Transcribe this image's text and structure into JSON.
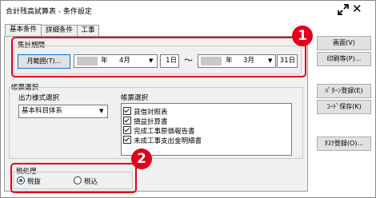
{
  "window": {
    "title": "合計残高試算表 - 条件設定"
  },
  "tabs": [
    {
      "label": "基本条件",
      "active": true
    },
    {
      "label": "詳細条件",
      "active": false
    },
    {
      "label": "工事",
      "active": false
    }
  ],
  "period": {
    "group_label": "集計期間",
    "range_button": "月範囲(T)...",
    "start_year_suffix": "年",
    "start_month": "4月",
    "start_day": "1日",
    "separator": "～",
    "end_year_suffix": "年",
    "end_month": "3月",
    "end_day": "31日"
  },
  "report_select": {
    "group_label": "帳票選択",
    "output_format_label": "出力様式選択",
    "output_format_value": "基本科目体系",
    "report_list_label": "帳票選択",
    "reports": [
      {
        "label": "貸借対照表",
        "checked": true
      },
      {
        "label": "損益計算書",
        "checked": true
      },
      {
        "label": "完成工事原価報告書",
        "checked": true
      },
      {
        "label": "未成工事支出金明細書",
        "checked": true
      }
    ]
  },
  "tax": {
    "group_label": "税処理",
    "options": [
      {
        "label": "税抜",
        "selected": true
      },
      {
        "label": "税込",
        "selected": false
      }
    ]
  },
  "side_buttons": {
    "screen": "画面(V)",
    "print": "印刷等(P)...",
    "pattern_register": "ﾊﾟﾀｰﾝ登録(E)",
    "code_save": "ｺｰﾄﾞ保存(K)",
    "task_register": "ﾀｽｸ登録(O)..."
  },
  "annotations": {
    "badge1": "1",
    "badge2": "2"
  },
  "colors": {
    "annotation_red": "#e0001a",
    "accent_blue": "#0078d7"
  }
}
